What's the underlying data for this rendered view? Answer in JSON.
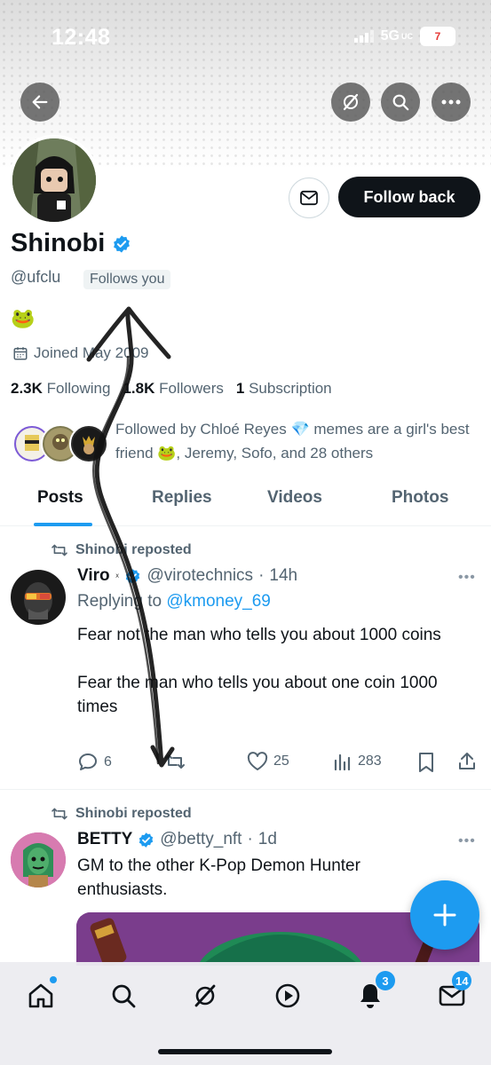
{
  "status_bar": {
    "time": "12:48",
    "network": "5G",
    "network_sub": "UC",
    "battery": "7"
  },
  "profile": {
    "name": "Shinobi",
    "handle": "@ufclu",
    "follows_you": "Follows you",
    "bio": "🐸",
    "joined": "Joined May 2009",
    "following_count": "2.3K",
    "following_label": "Following",
    "followers_count": "1.8K",
    "followers_label": "Followers",
    "subscription_count": "1",
    "subscription_label": "Subscription",
    "follow_back_label": "Follow back",
    "followed_by": "Followed by Chloé Reyes 💎 memes are a girl's best friend 🐸, Jeremy, Sofo, and 28 others"
  },
  "tabs": [
    "Posts",
    "Replies",
    "Videos",
    "Photos"
  ],
  "posts": [
    {
      "repost_label": "Shinobi reposted",
      "author": "Viro",
      "author_suffix": "ᕁ",
      "handle": "@virotechnics",
      "time": "14h",
      "reply_prefix": "Replying to",
      "reply_handle": "@kmoney_69",
      "text": "Fear not the man who tells you about 1000 coins\n\nFear the man who tells you about one coin 1000 times",
      "replies": "6",
      "reposts": "",
      "likes": "25",
      "views": "283"
    },
    {
      "repost_label": "Shinobi reposted",
      "author": "BETTY",
      "handle": "@betty_nft",
      "time": "1d",
      "text": "GM to the other K-Pop Demon Hunter enthusiasts."
    }
  ],
  "bottom_nav": {
    "notifications_badge": "3",
    "messages_badge": "14"
  },
  "colors": {
    "accent": "#1d9bf0",
    "text": "#0f1419",
    "secondary": "#536471"
  }
}
